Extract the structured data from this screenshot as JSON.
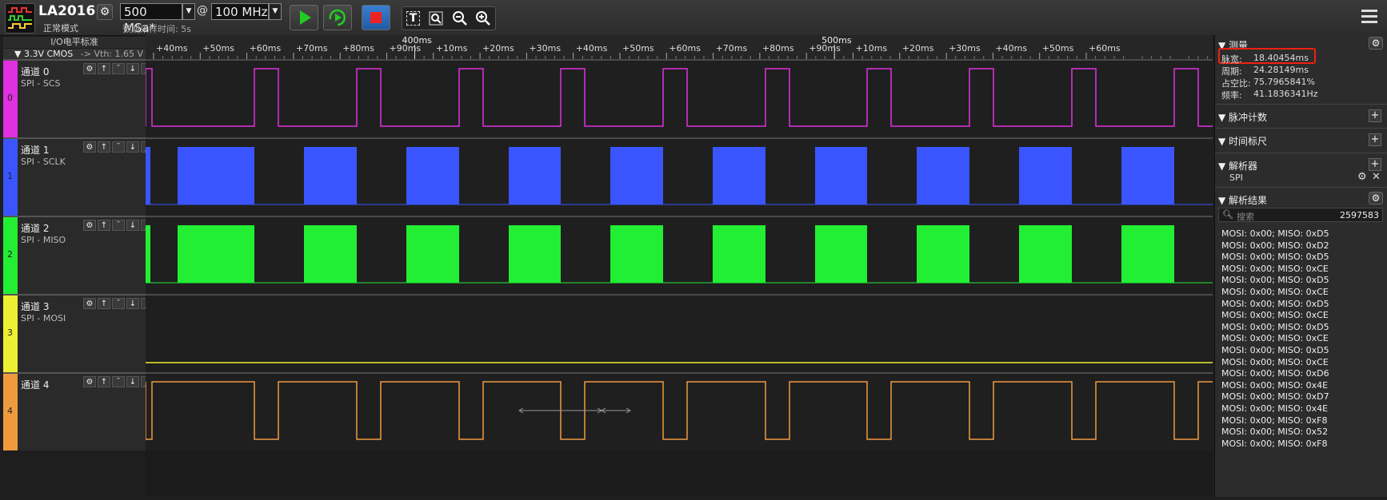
{
  "app": {
    "model": "LA2016",
    "mode": "正常模式",
    "sample_depth": "500 MSa*",
    "at": "@",
    "sample_rate": "100 MHz",
    "est_time": "预期采样时间: 5s"
  },
  "left_header": {
    "title": "I/O电平标准",
    "level": "▼ 3.3V CMOS",
    "vth": "-> Vth: 1.65 V"
  },
  "channels": [
    {
      "name": "通道 0",
      "sub": "SPI - SCS",
      "num": "0",
      "color": "#e030e0"
    },
    {
      "name": "通道 1",
      "sub": "SPI - SCLK",
      "num": "1",
      "color": "#3a55ff"
    },
    {
      "name": "通道 2",
      "sub": "SPI - MISO",
      "num": "2",
      "color": "#22ee33"
    },
    {
      "name": "通道 3",
      "sub": "SPI - MOSI",
      "num": "3",
      "color": "#eeee33"
    },
    {
      "name": "通道 4",
      "sub": "",
      "num": "4",
      "color": "#f09a40"
    }
  ],
  "ruler": {
    "ticks": [
      "+40ms",
      "+50ms",
      "+60ms",
      "+70ms",
      "+80ms",
      "+90ms",
      "+10ms",
      "+20ms",
      "+30ms",
      "+40ms",
      "+50ms",
      "+60ms",
      "+70ms",
      "+80ms",
      "+90ms",
      "+10ms",
      "+20ms",
      "+30ms",
      "+40ms",
      "+50ms",
      "+60ms"
    ],
    "major": [
      "400ms",
      "500ms"
    ]
  },
  "measure": {
    "title": "测量",
    "pulse_width_label": "脉宽:",
    "pulse_width": "18.40454ms",
    "period_label": "周期:",
    "period": "24.28149ms",
    "duty_label": "占空比:",
    "duty": "75.7965841%",
    "freq_label": "频率:",
    "freq": "41.1836341Hz"
  },
  "sections": {
    "pulse_count": "脉冲计数",
    "time_ruler": "时间标尺",
    "decoder": "解析器",
    "decoder_item": "SPI",
    "results": "解析结果",
    "search_placeholder": "搜索",
    "result_count": "2597583"
  },
  "results": [
    "MOSI: 0x00;  MISO: 0xD5",
    "MOSI: 0x00;  MISO: 0xD2",
    "MOSI: 0x00;  MISO: 0xD5",
    "MOSI: 0x00;  MISO: 0xCE",
    "MOSI: 0x00;  MISO: 0xD5",
    "MOSI: 0x00;  MISO: 0xCE",
    "MOSI: 0x00;  MISO: 0xD5",
    "MOSI: 0x00;  MISO: 0xCE",
    "MOSI: 0x00;  MISO: 0xD5",
    "MOSI: 0x00;  MISO: 0xCE",
    "MOSI: 0x00;  MISO: 0xD5",
    "MOSI: 0x00;  MISO: 0xCE",
    "MOSI: 0x00;  MISO: 0xD6",
    "MOSI: 0x00;  MISO: 0x4E",
    "MOSI: 0x00;  MISO: 0xD7",
    "MOSI: 0x00;  MISO: 0x4E",
    "MOSI: 0x00;  MISO: 0xF8",
    "MOSI: 0x00;  MISO: 0x52",
    "MOSI: 0x00;  MISO: 0xF8"
  ]
}
